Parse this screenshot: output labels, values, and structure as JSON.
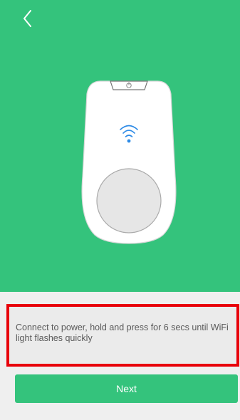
{
  "header": {
    "back_icon": "chevron-left-icon"
  },
  "illustration": {
    "device_icon": "smart-plug-illustration",
    "wifi_icon": "wifi-icon",
    "power_icon": "power-button-icon"
  },
  "instruction": {
    "text": "Connect to power, hold and press for 6 secs until WiFi light flashes quickly"
  },
  "actions": {
    "next_label": "Next"
  },
  "colors": {
    "accent": "#34c37c",
    "background": "#efefef",
    "highlight_border": "#e8000a",
    "wifi_blue": "#2e8be6"
  }
}
